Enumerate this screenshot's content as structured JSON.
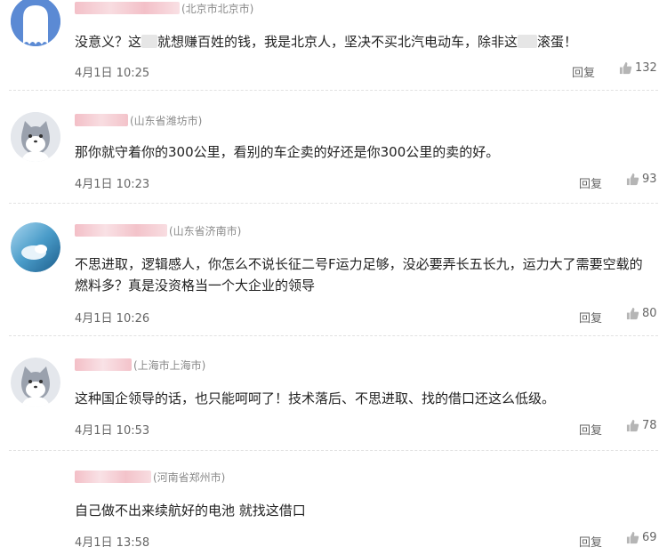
{
  "comments": [
    {
      "location": "(北京市北京市)",
      "text_before": "没意义？这",
      "text_middle": "就想赚百姓的钱，我是北京人，坚决不买北汽电动车，除非这",
      "text_after": "滚蛋！",
      "time": "4月1日 10:25",
      "reply": "回复",
      "likes": "132",
      "avatar": "ghost-avatar"
    },
    {
      "location": "(山东省潍坊市)",
      "text": "那你就守着你的300公里，看别的车企卖的好还是你300公里的卖的好。",
      "time": "4月1日 10:23",
      "reply": "回复",
      "likes": "93",
      "avatar": "cat-avatar"
    },
    {
      "location": "(山东省济南市)",
      "text": "不思进取，逻辑感人，你怎么不说长征二号F运力足够，没必要弄长五长九，运力大了需要空载的燃料多？真是没资格当一个大企业的领导",
      "time": "4月1日 10:26",
      "reply": "回复",
      "likes": "80",
      "avatar": "photo-avatar"
    },
    {
      "location": "(上海市上海市)",
      "text": "这种国企领导的话，也只能呵呵了！技术落后、不思进取、找的借口还这么低级。",
      "time": "4月1日 10:53",
      "reply": "回复",
      "likes": "78",
      "avatar": "cat-avatar"
    },
    {
      "location": "(河南省郑州市)",
      "text": "自己做不出来续航好的电池 就找这借口",
      "time": "4月1日 13:58",
      "reply": "回复",
      "likes": "69",
      "avatar": "none"
    }
  ],
  "colors": {
    "name_blur": "#f5c5cc",
    "location": "#8a8a8a",
    "meta_text": "#666666",
    "ghost_avatar_bg": "#5f8ed6",
    "cat_avatar_bg": "#dfe3ea"
  }
}
